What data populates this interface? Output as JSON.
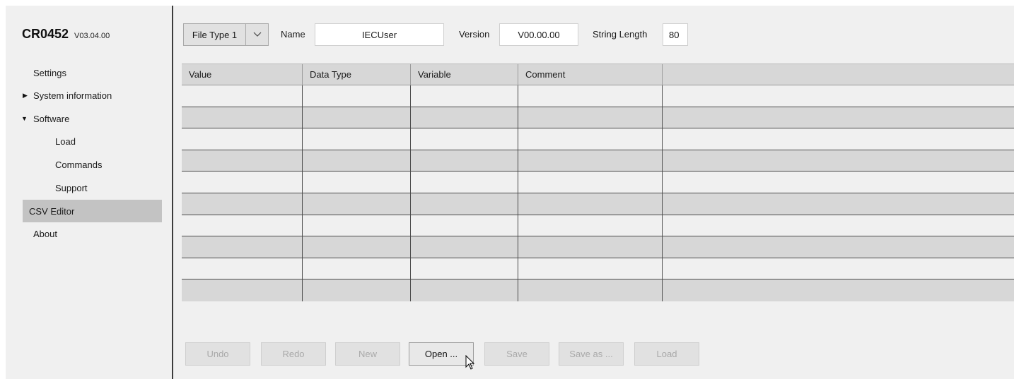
{
  "device": {
    "model": "CR0452",
    "version": "V03.04.00"
  },
  "sidebar": {
    "items": [
      {
        "label": "Settings"
      },
      {
        "label": "System information"
      },
      {
        "label": "Software"
      },
      {
        "label": "Load"
      },
      {
        "label": "Commands"
      },
      {
        "label": "Support"
      },
      {
        "label": "CSV Editor"
      },
      {
        "label": "About"
      }
    ],
    "icons": {
      "collapsed": "triangle-right-icon",
      "expanded": "triangle-down-icon"
    }
  },
  "toolbar": {
    "file_type": "File Type 1",
    "name_label": "Name",
    "name_value": "IECUser",
    "version_label": "Version",
    "version_value": "V00.00.00",
    "string_length_label": "String Length",
    "string_length_value": "80"
  },
  "table": {
    "columns": [
      "Value",
      "Data Type",
      "Variable",
      "Comment",
      ""
    ],
    "row_count": 10
  },
  "buttons": {
    "undo": "Undo",
    "redo": "Redo",
    "new": "New",
    "open": "Open ...",
    "save": "Save",
    "save_as": "Save as ...",
    "load": "Load"
  },
  "colors": {
    "active_nav": "#c3c3c3",
    "row_alt": "#d7d7d7",
    "panel": "#f0f0f0"
  }
}
